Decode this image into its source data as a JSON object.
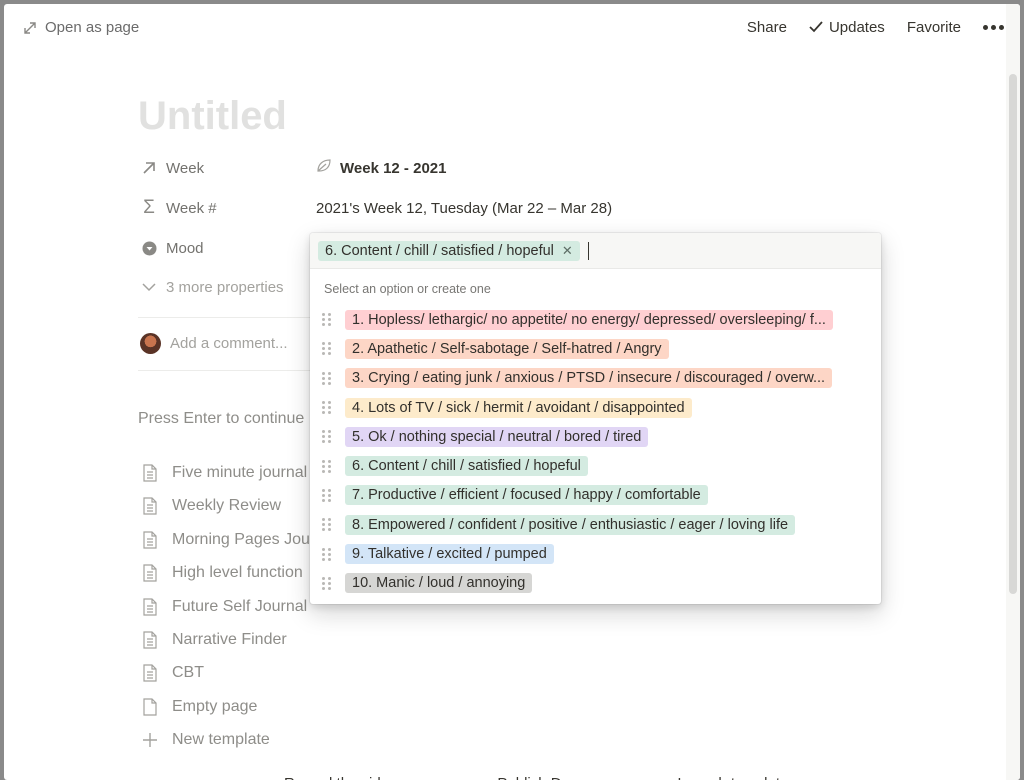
{
  "topbar": {
    "open_as_page": "Open as page",
    "share": "Share",
    "updates": "Updates",
    "favorite": "Favorite"
  },
  "page": {
    "title": "Untitled",
    "properties": [
      {
        "name": "Week",
        "icon": "arrow-up-right-icon",
        "value": "Week 12 - 2021",
        "value_icon": "leaf-icon"
      },
      {
        "name": "Week #",
        "icon": "sigma-icon",
        "value": "2021's Week 12, Tuesday (Mar 22 – Mar 28)"
      },
      {
        "name": "Mood",
        "icon": "select-icon"
      }
    ],
    "more_properties": "3 more properties",
    "comment_placeholder": "Add a comment...",
    "press_enter": "Press Enter to continue",
    "templates": [
      {
        "label": "Five minute journal",
        "icon": "page-text-icon"
      },
      {
        "label": "Weekly Review",
        "icon": "page-text-icon"
      },
      {
        "label": "Morning Pages Journal",
        "icon": "page-text-icon"
      },
      {
        "label": "High level function",
        "icon": "page-text-icon"
      },
      {
        "label": "Future Self Journal",
        "icon": "page-text-icon"
      },
      {
        "label": "Narrative Finder",
        "icon": "page-text-icon"
      },
      {
        "label": "CBT",
        "icon": "page-text-icon"
      },
      {
        "label": "Empty page",
        "icon": "page-empty-icon"
      },
      {
        "label": "New template",
        "icon": "plus-icon"
      }
    ],
    "bottom_strip": [
      "Record the video",
      "Publish Day",
      "Launch template"
    ]
  },
  "mood_popup": {
    "selected": {
      "label": "6. Content / chill / satisfied / hopeful",
      "color": "#dbeddb"
    },
    "hint": "Select an option or create one",
    "options": [
      {
        "label": "1. Hopless/ lethargic/ no appetite/ no energy/ depressed/ oversleeping/ f...",
        "color": "#ffcfd2"
      },
      {
        "label": "2. Apathetic / Self-sabotage / Self-hatred / Angry",
        "color": "#fdd6c6"
      },
      {
        "label": "3. Crying / eating junk / anxious / PTSD / insecure / discouraged / overw...",
        "color": "#fdd6c6"
      },
      {
        "label": "4. Lots of TV / sick / hermit / avoidant / disappointed",
        "color": "#fdebcb"
      },
      {
        "label": "5. Ok / nothing special / neutral / bored / tired",
        "color": "#e1d6f5"
      },
      {
        "label": "6. Content / chill / satisfied / hopeful",
        "color": "#d4ebe1"
      },
      {
        "label": "7. Productive / efficient / focused / happy / comfortable",
        "color": "#d4ebe1"
      },
      {
        "label": "8. Empowered / confident / positive / enthusiastic / eager / loving life",
        "color": "#d4ebe1"
      },
      {
        "label": "9. Talkative / excited / pumped",
        "color": "#d3e5f7"
      },
      {
        "label": "10. Manic / loud / annoying",
        "color": "#d6d6d4"
      }
    ]
  }
}
